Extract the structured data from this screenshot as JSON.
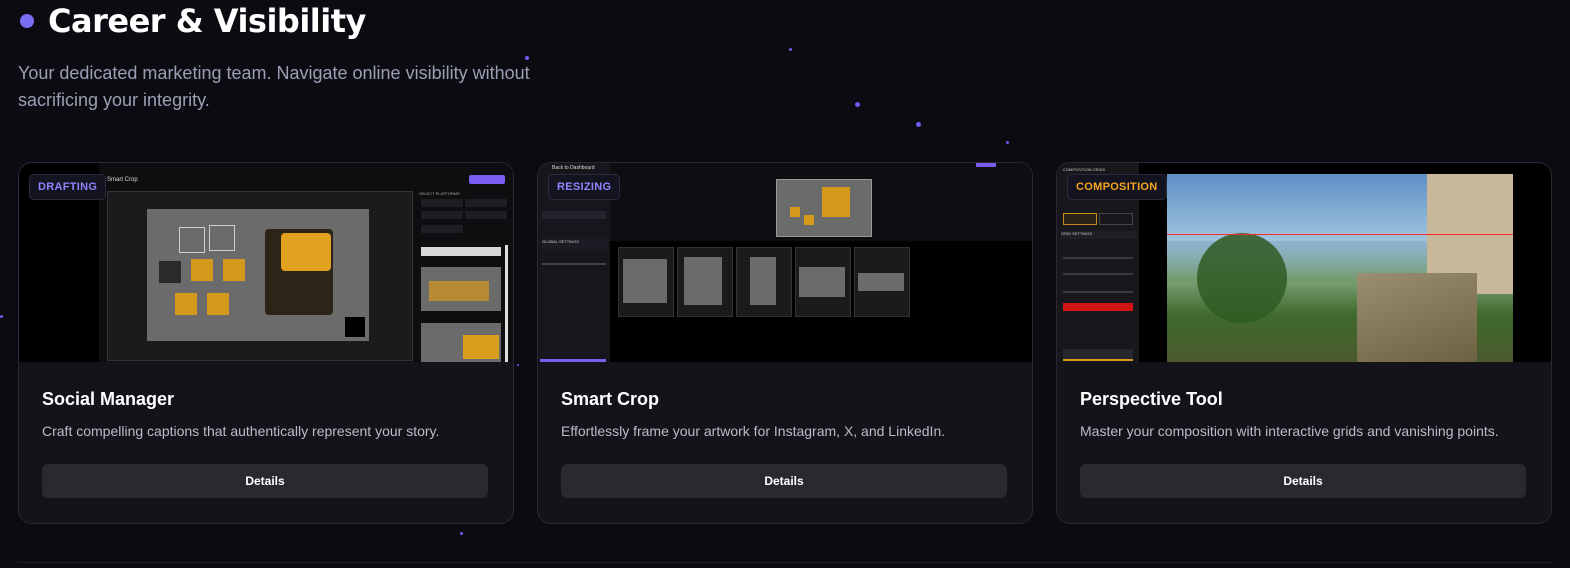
{
  "section": {
    "title": "Career & Visibility",
    "subtitle": "Your dedicated marketing team. Navigate online visibility without sacrificing your integrity."
  },
  "colors": {
    "accent": "#7a6cf5",
    "drafting_badge": "#8f86ff",
    "resizing_badge": "#8f86ff",
    "composition_badge": "#f5a623"
  },
  "cards": [
    {
      "badge": "DRAFTING",
      "title": "Social Manager",
      "description": "Craft compelling captions that authentically represent your story.",
      "button": "Details",
      "screenshot": {
        "app_label": "Smart Crop",
        "panel_label": "SELECT PLATFORMS"
      }
    },
    {
      "badge": "RESIZING",
      "title": "Smart Crop",
      "description": "Effortlessly frame your artwork for Instagram, X, and LinkedIn.",
      "button": "Details",
      "screenshot": {
        "app_label": "Back to Dashboard",
        "panel_label": "GLOBAL SETTINGS"
      }
    },
    {
      "badge": "COMPOSITION",
      "title": "Perspective Tool",
      "description": "Master your composition with interactive grids and vanishing points.",
      "button": "Details",
      "screenshot": {
        "app_label": "COMPOSITION GRIDS",
        "panel_label": "GRID SETTINGS"
      }
    }
  ]
}
